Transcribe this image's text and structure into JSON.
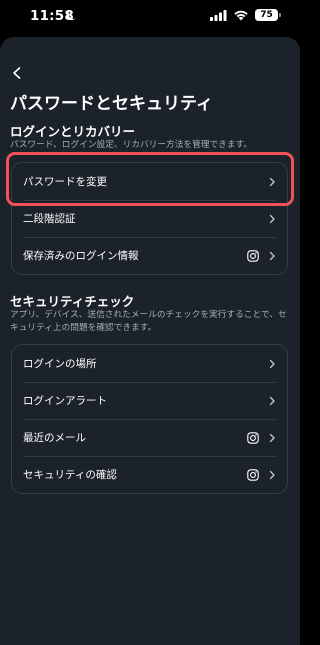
{
  "status_bar": {
    "time": "11:58",
    "battery": "75"
  },
  "header": {
    "title": "パスワードとセキュリティ"
  },
  "login_section": {
    "title": "ログインとリカバリー",
    "description": "パスワード、ログイン設定、リカバリー方法を管理できます。",
    "items": [
      {
        "label": "パスワードを変更",
        "icon": "chevron-right-icon"
      },
      {
        "label": "二段階認証",
        "icon": "chevron-right-icon"
      },
      {
        "label": "保存済みのログイン情報",
        "icon": "instagram-icon"
      }
    ]
  },
  "security_section": {
    "title": "セキュリティチェック",
    "description": "アプリ、デバイス、送信されたメールのチェックを実行することで、セキュリティ上の問題を確認できます。",
    "items": [
      {
        "label": "ログインの場所",
        "icon": "chevron-right-icon"
      },
      {
        "label": "ログインアラート",
        "icon": "chevron-right-icon"
      },
      {
        "label": "最近のメール",
        "icon": "instagram-icon"
      },
      {
        "label": "セキュリティの確認",
        "icon": "instagram-icon"
      }
    ]
  },
  "colors": {
    "background": "#1b2229",
    "highlight": "#ef5358",
    "secondary_text": "#a7adb3"
  }
}
